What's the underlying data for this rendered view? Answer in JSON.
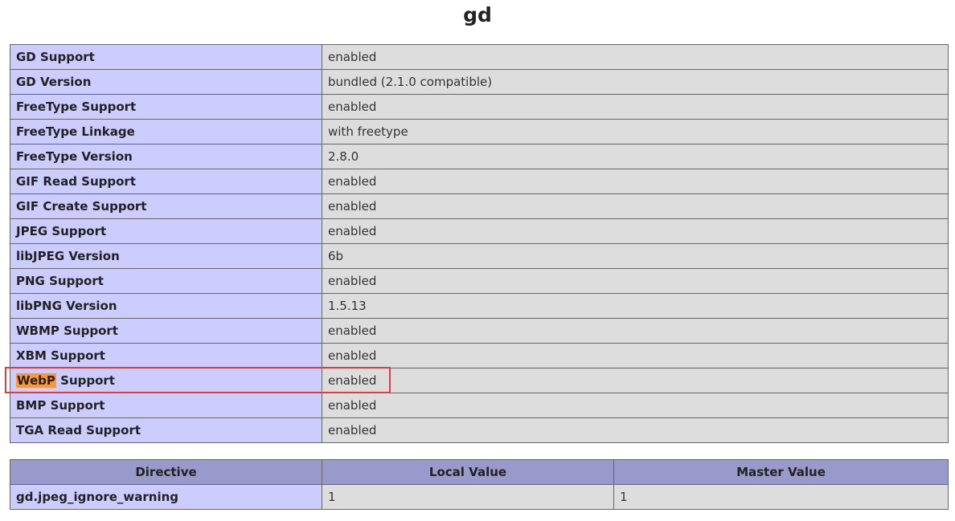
{
  "title": "gd",
  "info_rows": [
    {
      "key": "GD Support",
      "value": "enabled"
    },
    {
      "key": "GD Version",
      "value": "bundled (2.1.0 compatible)"
    },
    {
      "key": "FreeType Support",
      "value": "enabled"
    },
    {
      "key": "FreeType Linkage",
      "value": "with freetype"
    },
    {
      "key": "FreeType Version",
      "value": "2.8.0"
    },
    {
      "key": "GIF Read Support",
      "value": "enabled"
    },
    {
      "key": "GIF Create Support",
      "value": "enabled"
    },
    {
      "key": "JPEG Support",
      "value": "enabled"
    },
    {
      "key": "libJPEG Version",
      "value": "6b"
    },
    {
      "key": "PNG Support",
      "value": "enabled"
    },
    {
      "key": "libPNG Version",
      "value": "1.5.13"
    },
    {
      "key": "WBMP Support",
      "value": "enabled"
    },
    {
      "key": "XBM Support",
      "value": "enabled"
    },
    {
      "key_highlight": "WebP",
      "key_rest": " Support",
      "value": "enabled"
    },
    {
      "key": "BMP Support",
      "value": "enabled"
    },
    {
      "key": "TGA Read Support",
      "value": "enabled"
    }
  ],
  "directives": {
    "headers": [
      "Directive",
      "Local Value",
      "Master Value"
    ],
    "rows": [
      {
        "directive": "gd.jpeg_ignore_warning",
        "local": "1",
        "master": "1"
      }
    ]
  },
  "colors": {
    "key_cell": "#ccccff",
    "value_cell": "#dddddd",
    "header_cell": "#9999cc",
    "search_highlight": "#ff9632",
    "annotation_box": "#e03c3c"
  }
}
